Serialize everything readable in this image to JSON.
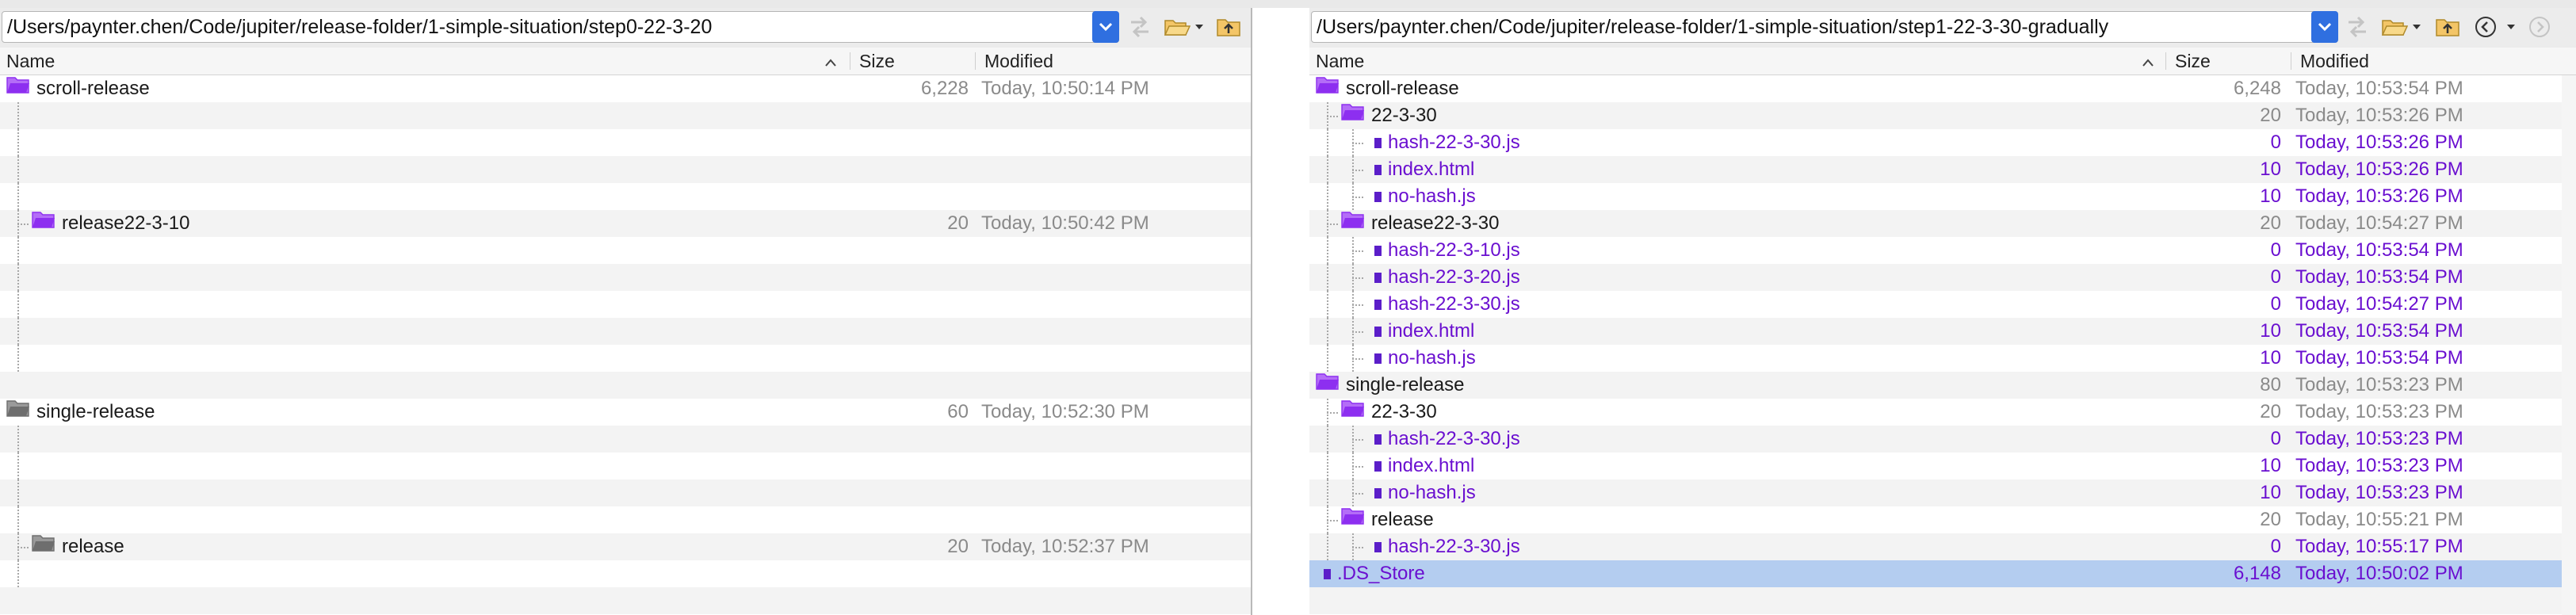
{
  "columns": {
    "name": "Name",
    "size": "Size",
    "modified": "Modified"
  },
  "colors": {
    "changed": "#6a0fd0",
    "unchanged": "#8a8a8a",
    "selection": "#b4cdf0",
    "accent": "#2f6fe0"
  },
  "left": {
    "path": "/Users/paynter.chen/Code/jupiter/release-folder/1-simple-situation/step0-22-3-20",
    "rows": [
      {
        "name": "scroll-release",
        "size": "6,228",
        "modified": "Today, 10:50:14 PM",
        "kind": "folder",
        "folder_color": "purple",
        "depth": 0
      },
      {
        "name": "",
        "size": "",
        "modified": "",
        "kind": "empty",
        "depth": 1
      },
      {
        "name": "",
        "size": "",
        "modified": "",
        "kind": "empty",
        "depth": 1
      },
      {
        "name": "",
        "size": "",
        "modified": "",
        "kind": "empty",
        "depth": 1
      },
      {
        "name": "",
        "size": "",
        "modified": "",
        "kind": "empty",
        "depth": 1
      },
      {
        "name": "release22-3-10",
        "size": "20",
        "modified": "Today, 10:50:42 PM",
        "kind": "folder",
        "folder_color": "purple",
        "depth": 1
      },
      {
        "name": "",
        "size": "",
        "modified": "",
        "kind": "empty",
        "depth": 1
      },
      {
        "name": "",
        "size": "",
        "modified": "",
        "kind": "empty",
        "depth": 1
      },
      {
        "name": "",
        "size": "",
        "modified": "",
        "kind": "empty",
        "depth": 1
      },
      {
        "name": "",
        "size": "",
        "modified": "",
        "kind": "empty",
        "depth": 1
      },
      {
        "name": "",
        "size": "",
        "modified": "",
        "kind": "empty",
        "depth": 1
      },
      {
        "name": "",
        "size": "",
        "modified": "",
        "kind": "empty",
        "depth": 0
      },
      {
        "name": "single-release",
        "size": "60",
        "modified": "Today, 10:52:30 PM",
        "kind": "folder",
        "folder_color": "gray",
        "depth": 0
      },
      {
        "name": "",
        "size": "",
        "modified": "",
        "kind": "empty",
        "depth": 1
      },
      {
        "name": "",
        "size": "",
        "modified": "",
        "kind": "empty",
        "depth": 1
      },
      {
        "name": "",
        "size": "",
        "modified": "",
        "kind": "empty",
        "depth": 1
      },
      {
        "name": "",
        "size": "",
        "modified": "",
        "kind": "empty",
        "depth": 1
      },
      {
        "name": "release",
        "size": "20",
        "modified": "Today, 10:52:37 PM",
        "kind": "folder",
        "folder_color": "gray",
        "depth": 1
      },
      {
        "name": "",
        "size": "",
        "modified": "",
        "kind": "empty",
        "depth": 1
      },
      {
        "name": "",
        "size": "",
        "modified": "",
        "kind": "empty",
        "depth": 0
      }
    ]
  },
  "right": {
    "path": "/Users/paynter.chen/Code/jupiter/release-folder/1-simple-situation/step1-22-3-30-gradually",
    "rows": [
      {
        "name": "scroll-release",
        "size": "6,248",
        "modified": "Today, 10:53:54 PM",
        "kind": "folder",
        "folder_color": "purple",
        "depth": 0,
        "tone": "gray"
      },
      {
        "name": "22-3-30",
        "size": "20",
        "modified": "Today, 10:53:26 PM",
        "kind": "folder",
        "folder_color": "purple",
        "depth": 1,
        "tone": "gray"
      },
      {
        "name": "hash-22-3-30.js",
        "size": "0",
        "modified": "Today, 10:53:26 PM",
        "kind": "file",
        "depth": 2,
        "tone": "purple"
      },
      {
        "name": "index.html",
        "size": "10",
        "modified": "Today, 10:53:26 PM",
        "kind": "file",
        "depth": 2,
        "tone": "purple"
      },
      {
        "name": "no-hash.js",
        "size": "10",
        "modified": "Today, 10:53:26 PM",
        "kind": "file",
        "depth": 2,
        "tone": "purple"
      },
      {
        "name": "release22-3-30",
        "size": "20",
        "modified": "Today, 10:54:27 PM",
        "kind": "folder",
        "folder_color": "purple",
        "depth": 1,
        "tone": "gray"
      },
      {
        "name": "hash-22-3-10.js",
        "size": "0",
        "modified": "Today, 10:53:54 PM",
        "kind": "file",
        "depth": 2,
        "tone": "purple"
      },
      {
        "name": "hash-22-3-20.js",
        "size": "0",
        "modified": "Today, 10:53:54 PM",
        "kind": "file",
        "depth": 2,
        "tone": "purple"
      },
      {
        "name": "hash-22-3-30.js",
        "size": "0",
        "modified": "Today, 10:54:27 PM",
        "kind": "file",
        "depth": 2,
        "tone": "purple"
      },
      {
        "name": "index.html",
        "size": "10",
        "modified": "Today, 10:53:54 PM",
        "kind": "file",
        "depth": 2,
        "tone": "purple"
      },
      {
        "name": "no-hash.js",
        "size": "10",
        "modified": "Today, 10:53:54 PM",
        "kind": "file",
        "depth": 2,
        "tone": "purple"
      },
      {
        "name": "single-release",
        "size": "80",
        "modified": "Today, 10:53:23 PM",
        "kind": "folder",
        "folder_color": "purple",
        "depth": 0,
        "tone": "gray"
      },
      {
        "name": "22-3-30",
        "size": "20",
        "modified": "Today, 10:53:23 PM",
        "kind": "folder",
        "folder_color": "purple",
        "depth": 1,
        "tone": "gray"
      },
      {
        "name": "hash-22-3-30.js",
        "size": "0",
        "modified": "Today, 10:53:23 PM",
        "kind": "file",
        "depth": 2,
        "tone": "purple"
      },
      {
        "name": "index.html",
        "size": "10",
        "modified": "Today, 10:53:23 PM",
        "kind": "file",
        "depth": 2,
        "tone": "purple"
      },
      {
        "name": "no-hash.js",
        "size": "10",
        "modified": "Today, 10:53:23 PM",
        "kind": "file",
        "depth": 2,
        "tone": "purple"
      },
      {
        "name": "release",
        "size": "20",
        "modified": "Today, 10:55:21 PM",
        "kind": "folder",
        "folder_color": "purple",
        "depth": 1,
        "tone": "gray"
      },
      {
        "name": "hash-22-3-30.js",
        "size": "0",
        "modified": "Today, 10:55:17 PM",
        "kind": "file",
        "depth": 2,
        "tone": "purple"
      },
      {
        "name": ".DS_Store",
        "size": "6,148",
        "modified": "Today, 10:50:02 PM",
        "kind": "file",
        "depth": 0,
        "tone": "purple",
        "selected": true
      },
      {
        "name": "",
        "size": "",
        "modified": "",
        "kind": "empty",
        "depth": 0
      }
    ]
  }
}
